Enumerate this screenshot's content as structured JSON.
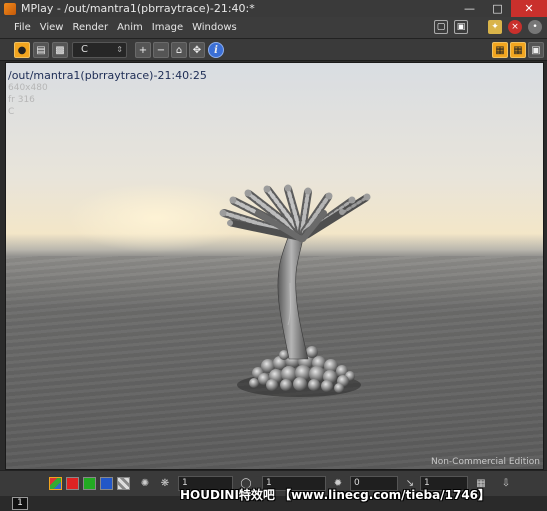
{
  "window": {
    "title": "MPlay - /out/mantra1(pbrraytrace)-21:40:*"
  },
  "menu": {
    "items": [
      "File",
      "View",
      "Render",
      "Anim",
      "Image",
      "Windows"
    ]
  },
  "toolbar": {
    "channel": "C"
  },
  "viewport": {
    "render_label": "/out/mantra1(pbrraytrace)-21:40:25",
    "resolution": "640x480",
    "frame_info": "fr 316",
    "channel": "C",
    "license_note": "Non-Commercial Edition"
  },
  "bottombar": {
    "field1": "1",
    "field2": "1",
    "field3": "0",
    "field4": "1"
  },
  "statusbar": {
    "frame": "1"
  },
  "watermark": "HOUDINI特效吧 【www.linecg.com/tieba/1746】",
  "colors": {
    "accent": "#f2a51f",
    "close": "#c9302c",
    "title_text": "#1d2d55"
  }
}
